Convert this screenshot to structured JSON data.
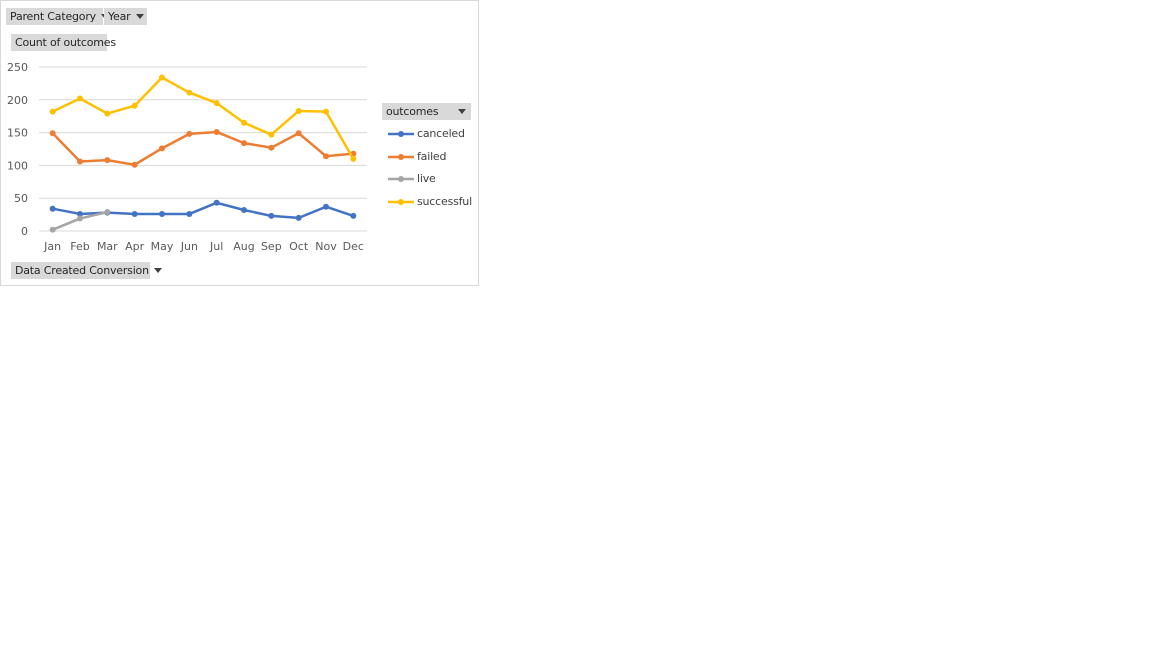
{
  "filters": {
    "parent_category_label": "Parent Category",
    "year_label": "Year",
    "values_label": "Count of outcomes",
    "axis_field_label": "Data Created Conversion",
    "legend_field_label": "outcomes"
  },
  "chart_data": {
    "type": "line",
    "title": "",
    "xlabel": "",
    "ylabel": "",
    "ylim": [
      0,
      250
    ],
    "yticks": [
      0,
      50,
      100,
      150,
      200,
      250
    ],
    "grid": true,
    "legend_position": "right",
    "categories": [
      "Jan",
      "Feb",
      "Mar",
      "Apr",
      "May",
      "Jun",
      "Jul",
      "Aug",
      "Sep",
      "Oct",
      "Nov",
      "Dec"
    ],
    "series": [
      {
        "name": "canceled",
        "color": "#4472c4",
        "values": [
          34,
          26,
          28,
          26,
          26,
          26,
          43,
          32,
          23,
          20,
          37,
          23
        ]
      },
      {
        "name": "failed",
        "color": "#ed7d31",
        "values": [
          149,
          106,
          108,
          101,
          126,
          148,
          151,
          134,
          127,
          149,
          114,
          118
        ]
      },
      {
        "name": "live",
        "color": "#a5a5a5",
        "values": [
          2,
          19,
          29,
          null,
          null,
          null,
          null,
          null,
          null,
          null,
          null,
          null
        ]
      },
      {
        "name": "successful",
        "color": "#ffc000",
        "values": [
          182,
          202,
          179,
          191,
          234,
          211,
          195,
          165,
          147,
          183,
          182,
          110
        ]
      }
    ]
  }
}
